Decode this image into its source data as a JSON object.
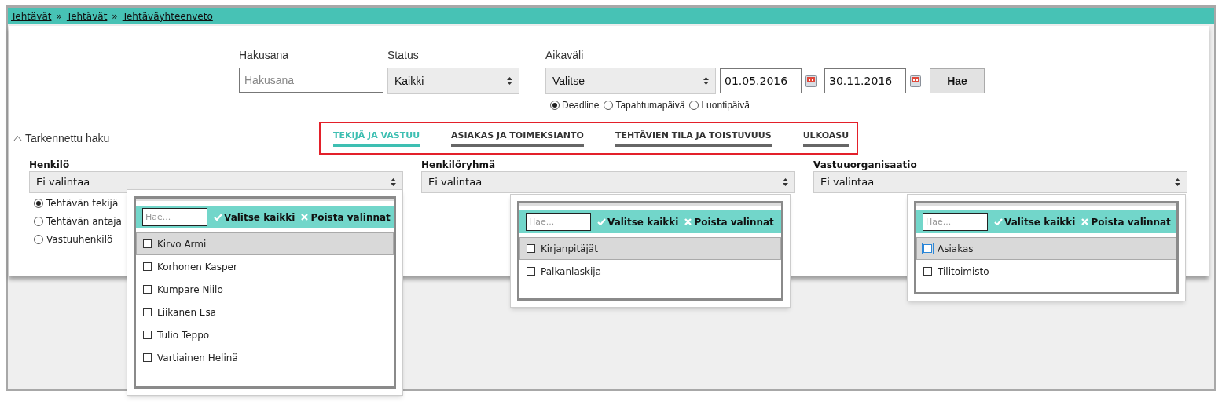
{
  "breadcrumbs": [
    {
      "label": "Tehtävät"
    },
    {
      "label": "Tehtävät"
    },
    {
      "label": "Tehtäväyhteenveto"
    }
  ],
  "breadcrumb_separator": "»",
  "search": {
    "keyword": {
      "label": "Hakusana",
      "placeholder": "Hakusana"
    },
    "status": {
      "label": "Status",
      "value": "Kaikki"
    },
    "period": {
      "label": "Aikaväli",
      "value": "Valitse",
      "start": "01.05.2016",
      "end": "30.11.2016",
      "date_types": [
        {
          "label": "Deadline",
          "selected": true
        },
        {
          "label": "Tapahtumapäivä",
          "selected": false
        },
        {
          "label": "Luontipäivä",
          "selected": false
        }
      ]
    },
    "button": "Hae"
  },
  "advanced": {
    "label": "Tarkennettu haku",
    "expanded": true
  },
  "tabs": [
    {
      "label": "TEKIJÄ JA VASTUU",
      "selected": true
    },
    {
      "label": "ASIAKAS JA TOIMEKSIANTO",
      "selected": false
    },
    {
      "label": "TEHTÄVIEN TILA JA TOISTUVUUS",
      "selected": false
    },
    {
      "label": "ULKOASU",
      "selected": false
    }
  ],
  "filters": [
    {
      "label": "Henkilö",
      "value": "Ei valintaa",
      "roles": [
        {
          "label": "Tehtävän tekijä",
          "selected": true
        },
        {
          "label": "Tehtävän antaja",
          "selected": false
        },
        {
          "label": "Vastuuhenkilö",
          "selected": false
        }
      ],
      "dropdown": {
        "placeholder": "Hae...",
        "select_all": "Valitse kaikki",
        "clear_all": "Poista valinnat",
        "options": [
          {
            "label": "Kirvo Armi",
            "checked": false,
            "selected": true,
            "focused": false
          },
          {
            "label": "Korhonen Kasper",
            "checked": false,
            "selected": false,
            "focused": false
          },
          {
            "label": "Kumpare Niilo",
            "checked": false,
            "selected": false,
            "focused": false
          },
          {
            "label": "Liikanen Esa",
            "checked": false,
            "selected": false,
            "focused": false
          },
          {
            "label": "Tulio Teppo",
            "checked": false,
            "selected": false,
            "focused": false
          },
          {
            "label": "Vartiainen Helinä",
            "checked": false,
            "selected": false,
            "focused": false
          }
        ]
      }
    },
    {
      "label": "Henkilöryhmä",
      "value": "Ei valintaa",
      "dropdown": {
        "placeholder": "Hae...",
        "select_all": "Valitse kaikki",
        "clear_all": "Poista valinnat",
        "options": [
          {
            "label": "Kirjanpitäjät",
            "checked": false,
            "selected": true,
            "focused": false
          },
          {
            "label": "Palkanlaskija",
            "checked": false,
            "selected": false,
            "focused": false
          }
        ]
      }
    },
    {
      "label": "Vastuuorganisaatio",
      "value": "Ei valintaa",
      "dropdown": {
        "placeholder": "Hae...",
        "select_all": "Valitse kaikki",
        "clear_all": "Poista valinnat",
        "options": [
          {
            "label": "Asiakas",
            "checked": false,
            "selected": true,
            "focused": true
          },
          {
            "label": "Tilitoimisto",
            "checked": false,
            "selected": false,
            "focused": false
          }
        ]
      }
    }
  ]
}
